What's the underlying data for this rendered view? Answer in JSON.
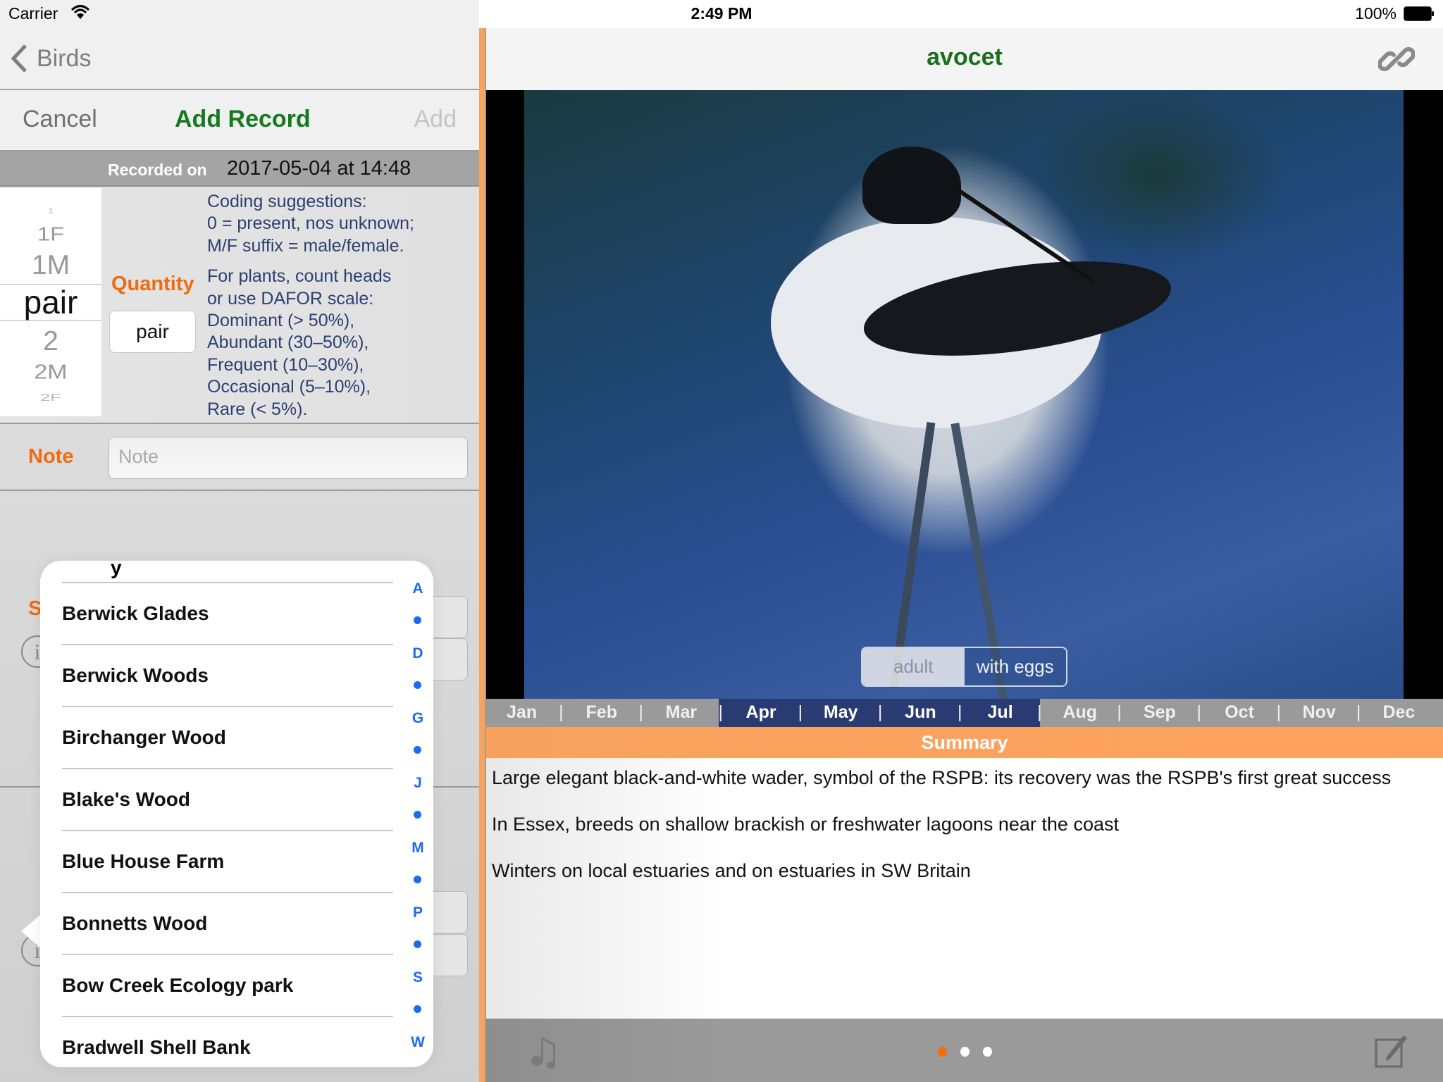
{
  "status_bar": {
    "carrier": "Carrier",
    "time": "2:49 PM",
    "battery": "100%"
  },
  "left": {
    "back_label": "Birds",
    "form": {
      "cancel": "Cancel",
      "title": "Add Record",
      "add": "Add"
    },
    "recorded": {
      "label": "Recorded on",
      "value": "2017-05-04 at 14:48"
    },
    "quantity": {
      "label": "Quantity",
      "value": "pair",
      "picker_options": [
        "1",
        "1F",
        "1M",
        "pair",
        "2",
        "2M",
        "2F"
      ],
      "selected": "pair"
    },
    "coding": {
      "p1": [
        "Coding suggestions:",
        "0 = present, nos unknown;",
        "M/F suffix = male/female."
      ],
      "p2": [
        "For plants, count heads",
        "or use DAFOR scale:",
        "Dominant (> 50%),",
        "Abundant (30–50%),",
        "Frequent (10–30%),",
        "Occasional (5–10%),",
        "Rare (< 5%)."
      ]
    },
    "note": {
      "label": "Note",
      "placeholder": "Note",
      "value": ""
    },
    "hidden_label_fragment": "S"
  },
  "site_popover": {
    "items": [
      "Berwick Glades",
      "Berwick Woods",
      "Birchanger Wood",
      "Blake's Wood",
      "Blue House Farm",
      "Bonnetts Wood",
      "Bow Creek Ecology park",
      "Bradwell Shell Bank"
    ],
    "index": [
      "A",
      "•",
      "D",
      "•",
      "G",
      "•",
      "J",
      "•",
      "M",
      "•",
      "P",
      "•",
      "S",
      "•",
      "W"
    ]
  },
  "right": {
    "species": "avocet",
    "segments": [
      {
        "label": "adult",
        "selected": false
      },
      {
        "label": "with eggs",
        "selected": true
      }
    ],
    "months": [
      "Jan",
      "Feb",
      "Mar",
      "Apr",
      "May",
      "Jun",
      "Jul",
      "Aug",
      "Sep",
      "Oct",
      "Nov",
      "Dec"
    ],
    "highlighted_months": [
      "Apr",
      "May",
      "Jun",
      "Jul"
    ],
    "summary_title": "Summary",
    "summary": [
      "Large elegant black-and-white wader, symbol of the RSPB: its recovery was the RSPB's first great success",
      "In Essex, breeds on shallow brackish or freshwater lagoons near the coast",
      "Winters on local estuaries and on estuaries in SW Britain"
    ],
    "page_dots": {
      "count": 3,
      "active": 1
    },
    "colors": {
      "accent_orange": "#f26d10",
      "title_green": "#1a6f1f",
      "month_highlight": "#2a3a73",
      "summary_band": "#ffa35e",
      "coding_text": "#2b3f72",
      "index_blue": "#1a6bf0"
    }
  }
}
